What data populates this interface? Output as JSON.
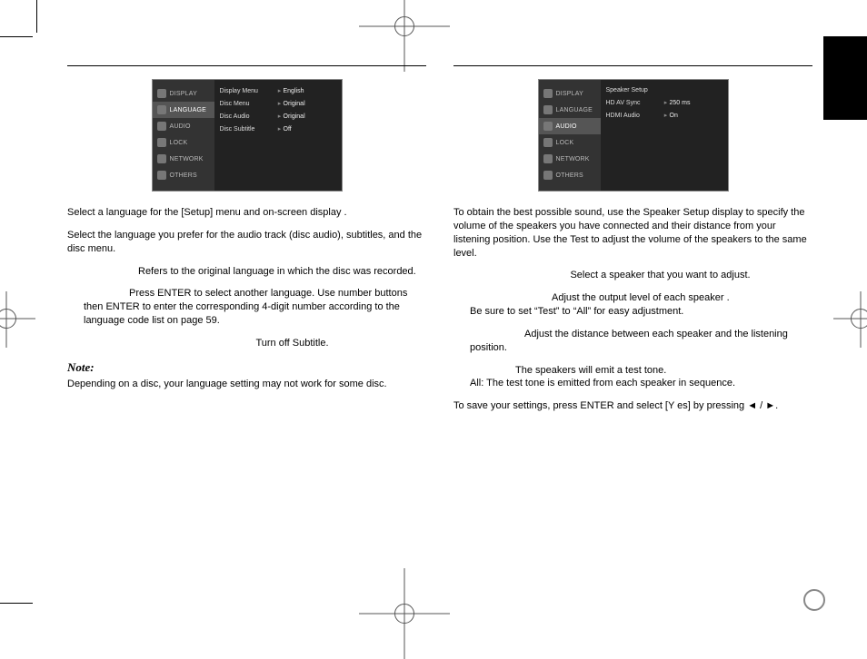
{
  "left": {
    "osd": {
      "sidebar": [
        "DISPLAY",
        "LANGUAGE",
        "AUDIO",
        "LOCK",
        "NETWORK",
        "OTHERS"
      ],
      "active_index": 1,
      "rows": [
        {
          "k": "Display Menu",
          "v": "English"
        },
        {
          "k": "Disc Menu",
          "v": "Original"
        },
        {
          "k": "Disc Audio",
          "v": "Original"
        },
        {
          "k": "Disc Subtitle",
          "v": "Off"
        }
      ]
    },
    "p1": "Select a language for the [Setup] menu and on-screen display .",
    "p2": "Select the language you prefer for the audio track (disc audio), subtitles, and the disc menu.",
    "p3": "Refers to the original language in which the disc was recorded.",
    "p4": "Press ENTER to select another language. Use number buttons then ENTER to enter the corresponding 4-digit number according to the language code list on page 59.",
    "p5": "Turn off Subtitle.",
    "note_label": "Note:",
    "note": "Depending on a disc, your language setting may not work for some disc."
  },
  "right": {
    "osd": {
      "sidebar": [
        "DISPLAY",
        "LANGUAGE",
        "AUDIO",
        "LOCK",
        "NETWORK",
        "OTHERS"
      ],
      "active_index": 2,
      "rows": [
        {
          "k": "Speaker Setup",
          "v": ""
        },
        {
          "k": "HD AV Sync",
          "v": "250 ms"
        },
        {
          "k": "HDMI Audio",
          "v": "On"
        }
      ]
    },
    "p1": "To obtain the best possible sound, use the Speaker Setup display to specify the volume of the speakers you have connected and their distance from your listening position. Use the Test to adjust the volume of the speakers to the same level.",
    "p2": "Select a speaker that you want to adjust.",
    "p3": "Adjust the output level of each speaker .",
    "p3b": "Be sure to set “Test” to “All” for easy adjustment.",
    "p4": "Adjust the distance between each speaker and the listening position.",
    "p5": "The speakers will emit a test tone.",
    "p5b": "All: The test tone is emitted from each speaker in sequence.",
    "p6": "To save your settings, press ENTER and select [Y es] by pressing ◄ / ►."
  }
}
